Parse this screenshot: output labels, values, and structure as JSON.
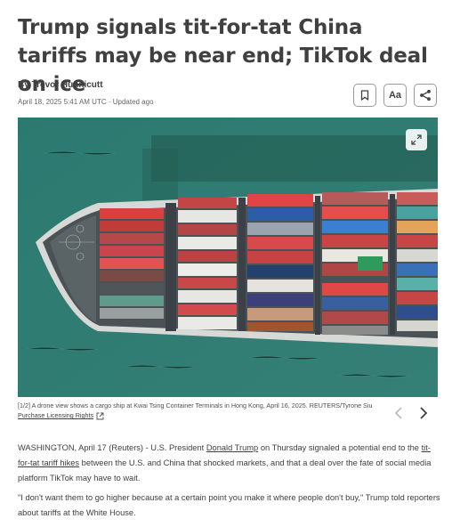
{
  "article": {
    "headline": "Trump signals tit-for-tat China tariffs may be near end; TikTok deal on ice",
    "byline_prefix": "By ",
    "author": "Trevor Hunnicutt",
    "dateline": "April 18, 2025 5:41 AM UTC · Updated ago"
  },
  "toolbar": {
    "bookmark_icon": "bookmark-icon",
    "text_size_label": "Aa",
    "share_icon": "share-icon"
  },
  "figure": {
    "description_icon": "expand-icon",
    "caption_text": "[1/2] A drone view shows a cargo ship at Kwai Tsing Container Terminals in Hong Kong, April 16, 2025. REUTERS/Tyrone Siu ",
    "licensing_link": "Purchase Licensing Rights",
    "prev_icon": "chevron-left-icon",
    "next_icon": "chevron-right-icon"
  },
  "body": {
    "p1_a": "WASHINGTON, April 17 (Reuters) - U.S. President ",
    "p1_link1": "Donald Trump",
    "p1_b": " on Thursday signaled a potential end to the ",
    "p1_link2": "tit-for-tat tariff hikes",
    "p1_c": " between the U.S. and China that shocked markets, and that a deal over the fate of social media platform TikTok may have to wait.",
    "p2": "\"I don't want them to go higher because at a certain point you make it where people don't buy,\" Trump told reporters about tariffs at the White House."
  },
  "colors": {
    "sea": "#2e7f74",
    "text": "#404040",
    "hull": "#3b4146"
  }
}
